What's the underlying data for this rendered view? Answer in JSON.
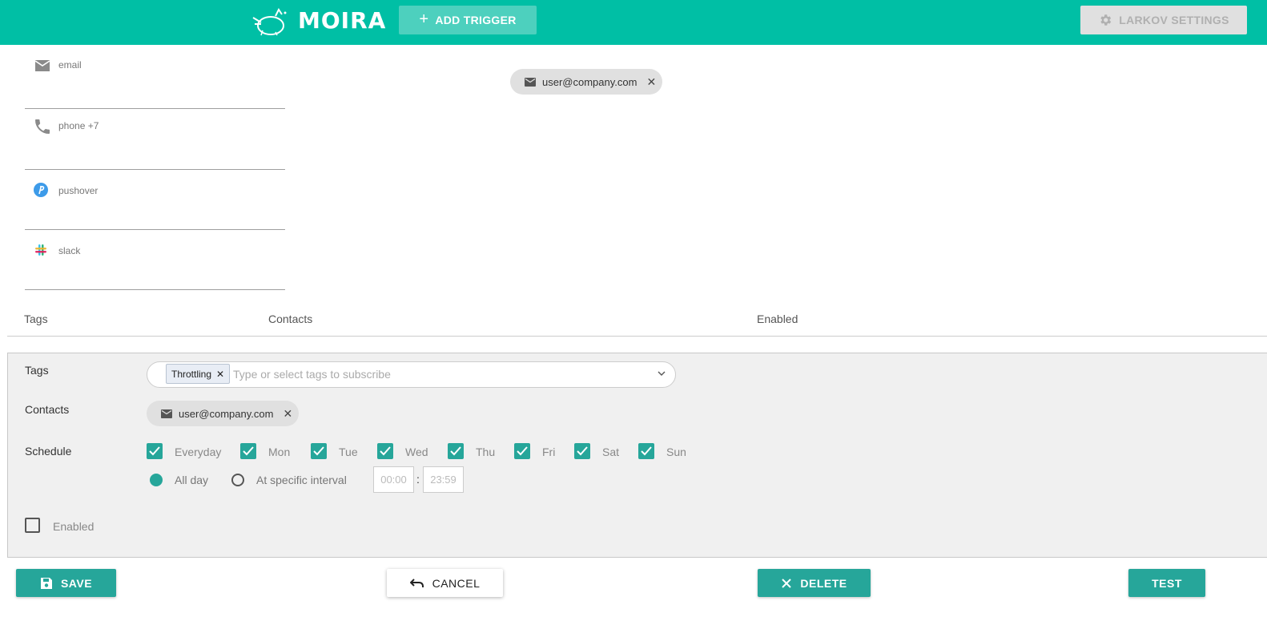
{
  "header": {
    "app_name": "MOIRA",
    "add_trigger_label": "ADD TRIGGER",
    "settings_label": "LARKOV SETTINGS",
    "accent_color": "#00bfa5"
  },
  "contact_types": [
    {
      "label": "email",
      "icon": "mail-icon"
    },
    {
      "label": "phone +7",
      "icon": "phone-icon"
    },
    {
      "label": "pushover",
      "icon": "pushover-icon"
    },
    {
      "label": "slack",
      "icon": "slack-icon"
    }
  ],
  "contacts_list": {
    "chip_label": "user@company.com"
  },
  "table_headers": {
    "tags": "Tags",
    "contacts": "Contacts",
    "enabled": "Enabled"
  },
  "edit": {
    "tags_label": "Tags",
    "selected_tag": "Throttling",
    "tags_placeholder": "Type or select tags to subscribe",
    "contacts_label": "Contacts",
    "contact_chip": "user@company.com",
    "schedule_label": "Schedule",
    "days": [
      {
        "label": "Everyday",
        "checked": true
      },
      {
        "label": "Mon",
        "checked": true
      },
      {
        "label": "Tue",
        "checked": true
      },
      {
        "label": "Wed",
        "checked": true
      },
      {
        "label": "Thu",
        "checked": true
      },
      {
        "label": "Fri",
        "checked": true
      },
      {
        "label": "Sat",
        "checked": true
      },
      {
        "label": "Sun",
        "checked": true
      }
    ],
    "all_day_label": "All day",
    "interval_label": "At specific interval",
    "time_from": "00:00",
    "time_sep": ":",
    "time_to": "23:59",
    "enabled_label": "Enabled",
    "enabled_checked": false
  },
  "actions": {
    "save": "SAVE",
    "cancel": "CANCEL",
    "delete": "DELETE",
    "test": "TEST"
  },
  "colors": {
    "primary": "#26a69a",
    "header": "#00bfa5"
  }
}
